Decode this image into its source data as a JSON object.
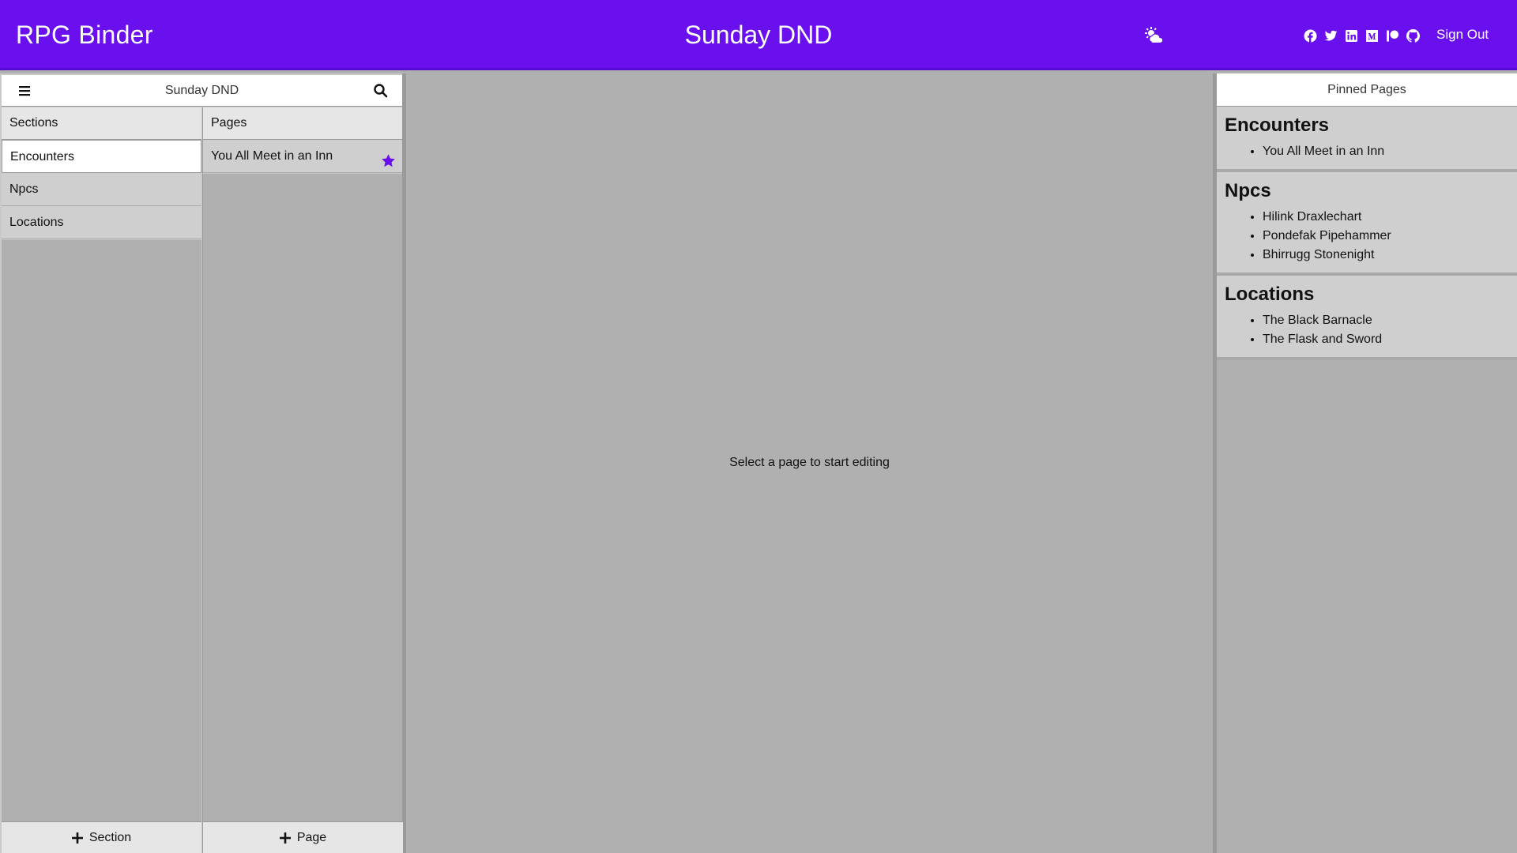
{
  "header": {
    "app_title": "RPG Binder",
    "binder_title": "Sunday DND",
    "weather_icon": "cloud-sun-icon",
    "social_icons": [
      "facebook-icon",
      "twitter-icon",
      "linkedin-icon",
      "medium-icon",
      "patreon-icon",
      "github-icon"
    ],
    "sign_out": "Sign Out",
    "bar_color": "#6a10ee"
  },
  "nav": {
    "binder_name": "Sunday DND",
    "sections_header": "Sections",
    "pages_header": "Pages",
    "sections": [
      {
        "label": "Encounters",
        "active": true
      },
      {
        "label": "Npcs",
        "active": false
      },
      {
        "label": "Locations",
        "active": false
      }
    ],
    "pages": [
      {
        "label": "You All Meet in an Inn",
        "pinned": true
      }
    ],
    "add_section": "Section",
    "add_page": "Page",
    "accent_color": "#6a10ee"
  },
  "main": {
    "placeholder": "Select a page to start editing"
  },
  "pinned": {
    "header": "Pinned Pages",
    "groups": [
      {
        "title": "Encounters",
        "items": [
          "You All Meet in an Inn"
        ]
      },
      {
        "title": "Npcs",
        "items": [
          "Hilink Draxlechart",
          "Pondefak Pipehammer",
          "Bhirrugg Stonenight"
        ]
      },
      {
        "title": "Locations",
        "items": [
          "The Black Barnacle",
          "The Flask and Sword"
        ]
      }
    ]
  }
}
